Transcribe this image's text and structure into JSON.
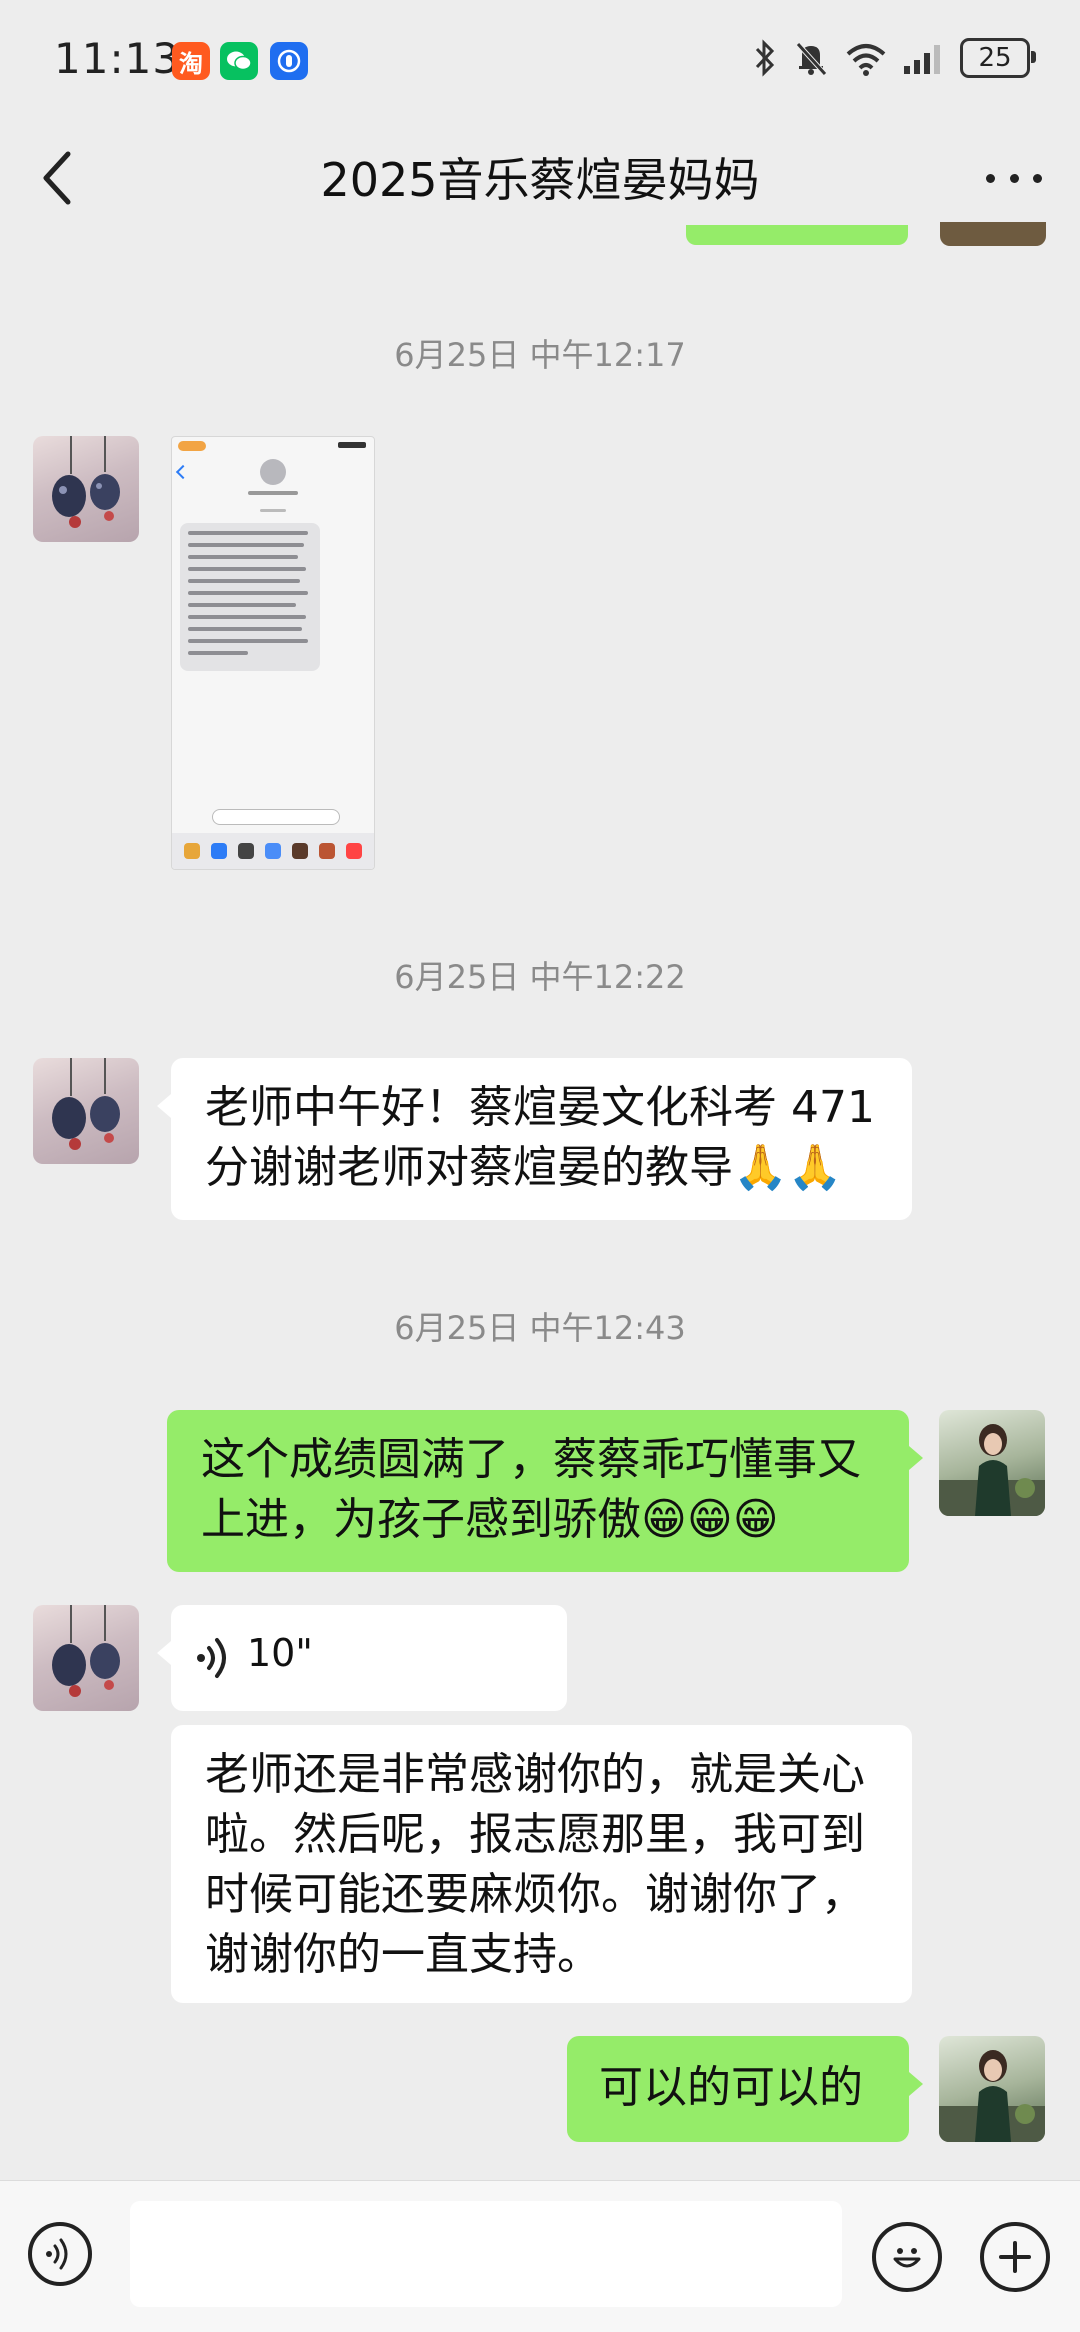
{
  "status_bar": {
    "time": "11:13",
    "apps": [
      "taobao-icon",
      "wechat-icon",
      "security-app-icon"
    ],
    "battery": "25"
  },
  "header": {
    "title": "2025音乐蔡煊晏妈妈"
  },
  "messages": {
    "ts1": "6月25日 中午12:17",
    "ts2": "6月25日 中午12:22",
    "ts3": "6月25日 中午12:43",
    "m_text1_line1": "老师中午好！蔡煊晏文化科考 471",
    "m_text1_line2": "分谢谢老师对蔡煊晏的教导🙏🙏",
    "m_text2_line1": "这个成绩圆满了，蔡蔡乖巧懂事又",
    "m_text2_line2": "上进，为孩子感到骄傲😁😁😁",
    "voice_duration": "10\"",
    "m_text3_line1": "老师还是非常感谢你的，就是关心",
    "m_text3_line2": "啦。然后呢，报志愿那里，我可到",
    "m_text3_line3": "时候可能还要麻烦你。谢谢你了，",
    "m_text3_line4": "谢谢你的一直支持。",
    "m_text4": "可以的可以的"
  },
  "colors": {
    "background": "#ededed",
    "self_bubble": "#95ec69",
    "other_bubble": "#ffffff"
  }
}
